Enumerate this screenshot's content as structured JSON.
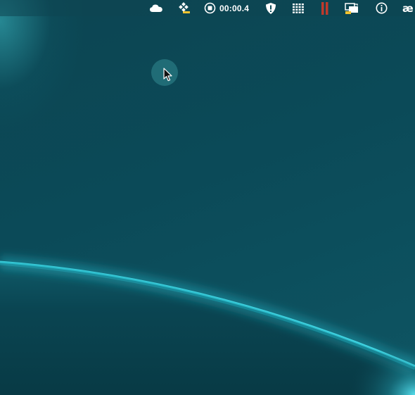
{
  "menubar": {
    "icons": [
      {
        "name": "cloud-icon"
      },
      {
        "name": "network-app-icon"
      },
      {
        "name": "stop-recording-icon"
      },
      {
        "name": "shield-icon"
      },
      {
        "name": "grid-icon"
      },
      {
        "name": "pause-bars-icon"
      },
      {
        "name": "display-mirror-icon"
      },
      {
        "name": "info-icon"
      }
    ],
    "timer": "00:00.4",
    "ae_label": "æ"
  },
  "colors": {
    "wallpaper_base": "#0b4753",
    "planet_glow": "#3fd6e6",
    "pause_bars": "#c0392b"
  }
}
